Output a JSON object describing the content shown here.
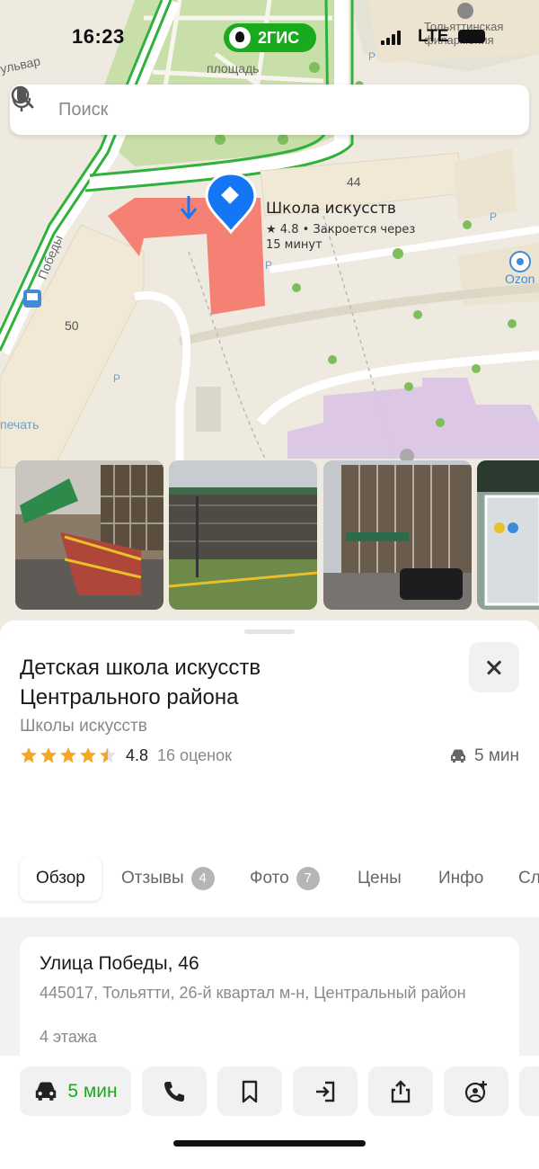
{
  "status_bar": {
    "time": "16:23",
    "network": "LTE"
  },
  "brand": {
    "name": "2ГИС",
    "color": "#19aa1e"
  },
  "search": {
    "placeholder": "Поиск",
    "icon": "search-icon",
    "mic_icon": "mic-icon"
  },
  "map": {
    "labels": {
      "square": "площадь",
      "street_top": "ульвар",
      "street_pobedy": "Победы",
      "theatre": "Тольяттинская филармония",
      "house_44": "44",
      "house_50": "50",
      "ozon": "Ozon",
      "print": "печать",
      "parking": "P"
    },
    "poi": {
      "title": "Школа искусств",
      "line1": "★ 4.8 • Закроется через",
      "line2": "15 минут"
    }
  },
  "photos": [
    "Фото 1",
    "Фото 2",
    "Фото 3",
    "Фото 4"
  ],
  "place": {
    "title": "Детская школа искусств Центрального района",
    "category": "Школы искусств",
    "rating": 4.8,
    "rating_text": "4.8",
    "stars_filled": 4.5,
    "reviews_count": "16 оценок",
    "drive_time": "5 мин"
  },
  "tabs": [
    {
      "label": "Обзор",
      "active": true
    },
    {
      "label": "Отзывы",
      "badge": "4"
    },
    {
      "label": "Фото",
      "badge": "7"
    },
    {
      "label": "Цены"
    },
    {
      "label": "Инфо"
    },
    {
      "label": "Сл"
    }
  ],
  "address": {
    "street": "Улица Победы, 46",
    "details": "445017, Тольятти, 26-й квартал м-н, Центральный район",
    "floors": "4 этажа"
  },
  "actions": {
    "route_label": "5 мин",
    "items": [
      "car-icon",
      "phone-icon",
      "bookmark-icon",
      "enter-icon",
      "share-icon",
      "add-contact-icon"
    ]
  },
  "colors": {
    "accent_green": "#19aa1e",
    "star": "#f5a623",
    "pin_blue": "#1476f5",
    "building_red": "#f5776a",
    "building_purple": "#d9c3e6"
  }
}
